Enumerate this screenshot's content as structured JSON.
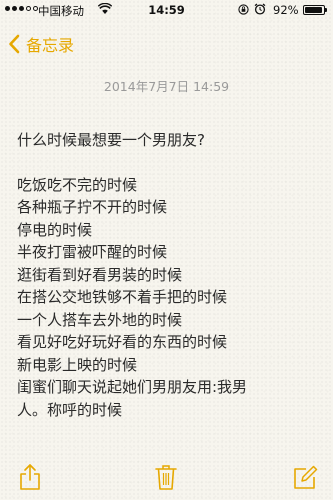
{
  "status_bar": {
    "carrier": "中国移动",
    "time": "14:59",
    "battery_percent": "92%",
    "battery_level": 0.92
  },
  "nav": {
    "back_label": "备忘录",
    "accent_color": "#e6a800"
  },
  "note": {
    "timestamp": "2014年7月7日 14:59",
    "title": "什么时候最想要一个男朋友?",
    "lines": [
      "吃饭吃不完的时候",
      "各种瓶子拧不开的时候",
      "停电的时候",
      "半夜打雷被吓醒的时候",
      "逛街看到好看男装的时候",
      "在搭公交地铁够不着手把的时候",
      "一个人搭车去外地的时候",
      "看见好吃好玩好看的东西的时候",
      "新电影上映的时候",
      "闺蜜们聊天说起她们男朋友用:我男",
      "人。称呼的时候"
    ]
  },
  "toolbar": {
    "icons": [
      "share-icon",
      "trash-icon",
      "compose-icon"
    ]
  }
}
